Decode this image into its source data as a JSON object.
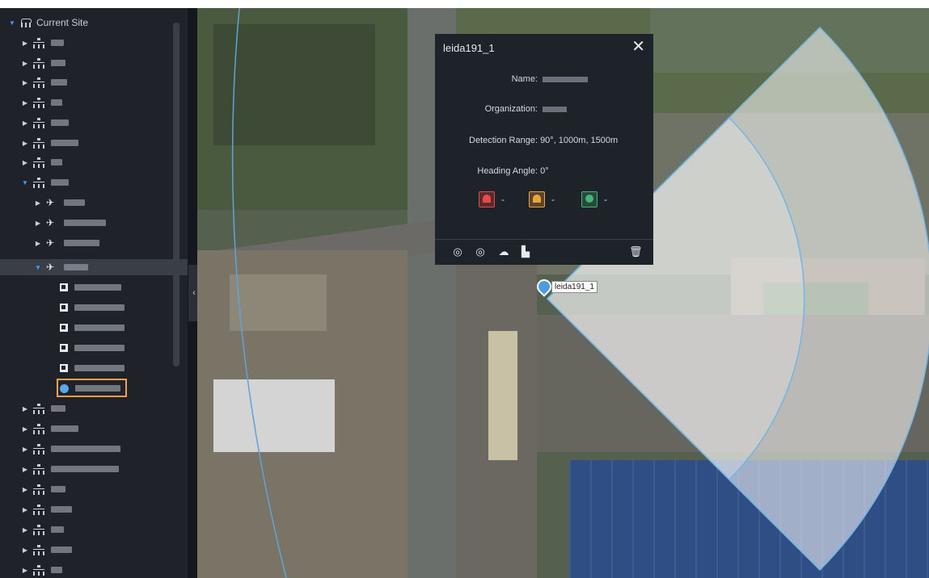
{
  "sidebar": {
    "root_label": "Current Site",
    "collapse_glyph": "‹"
  },
  "popup": {
    "title": "leida191_1",
    "close_glyph": "✕",
    "name_label": "Name:",
    "organization_label": "Organization:",
    "detection_range_label": "Detection Range:",
    "detection_range_value": "90°, 1000m, 1500m",
    "heading_angle_label": "Heading Angle:",
    "heading_angle_value": "0°",
    "alarm_dash_1": "-",
    "alarm_dash_2": "-",
    "alarm_dash_3": "-",
    "tools": [
      "radar-track-icon",
      "radar-zone-icon",
      "cloud-upload-icon",
      "chart-icon",
      "trash-icon"
    ]
  },
  "map": {
    "marker_label": "leida191_1",
    "sector_fill": "#ffffff",
    "sector_stroke": "#6fb7e9"
  },
  "colors": {
    "sidebar_bg": "#1f2329",
    "accent": "#3aa0ff",
    "highlight": "#f0a04b",
    "alarm_red": "#e24c4c",
    "alarm_orange": "#f0a13c",
    "alarm_green": "#40b774"
  }
}
